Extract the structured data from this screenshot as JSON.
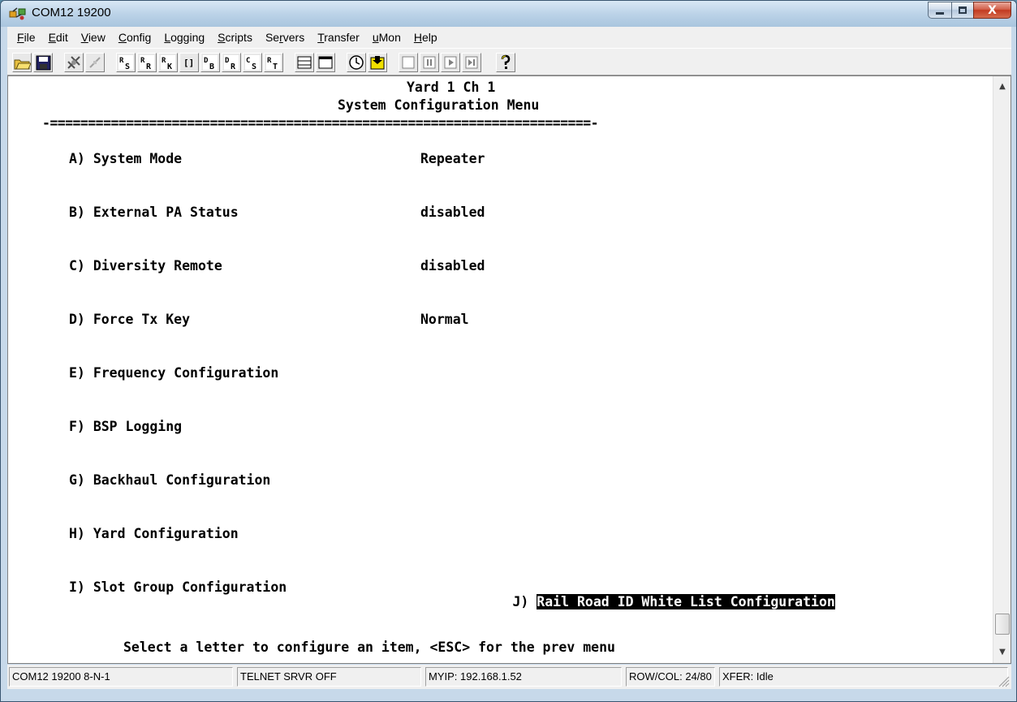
{
  "window": {
    "title": "COM12 19200",
    "controls": {
      "minimize": "minimize",
      "maximize": "maximize",
      "close": "X"
    }
  },
  "menu": [
    {
      "label": "File",
      "ul": "F",
      "rest": "ile"
    },
    {
      "label": "Edit",
      "ul": "E",
      "rest": "dit"
    },
    {
      "label": "View",
      "ul": "V",
      "rest": "iew"
    },
    {
      "label": "Config",
      "ul": "C",
      "rest": "onfig"
    },
    {
      "label": "Logging",
      "ul": "L",
      "rest": "ogging"
    },
    {
      "label": "Scripts",
      "ul": "S",
      "rest": "cripts"
    },
    {
      "label": "Servers",
      "pre": "Se",
      "ul": "r",
      "rest": "vers"
    },
    {
      "label": "Transfer",
      "ul": "T",
      "rest": "ransfer"
    },
    {
      "label": "uMon",
      "ul": "u",
      "rest": "Mon"
    },
    {
      "label": "Help",
      "ul": "H",
      "rest": "elp"
    }
  ],
  "toolbar_icons": [
    "open-folder-icon",
    "save-icon",
    "connect-icon",
    "disconnect-icon",
    "send-s-icon",
    "receive-r-icon",
    "receive-k-icon",
    "brackets-icon",
    "send-b-icon",
    "send-r-icon",
    "send-c-icon",
    "receive-t-icon",
    "window-split-icon",
    "window-icon",
    "clock-icon",
    "folder-arrow-icon",
    "stop-icon",
    "pause-icon",
    "play-icon",
    "step-icon",
    "help-icon"
  ],
  "terminal": {
    "header1": "Yard 1 Ch 1",
    "header2": "System Configuration Menu",
    "divider": "-=======================================================================-",
    "items": [
      {
        "key": "A)",
        "label": "System Mode",
        "value": "Repeater"
      },
      {
        "key": "B)",
        "label": "External PA Status",
        "value": "disabled"
      },
      {
        "key": "C)",
        "label": "Diversity Remote",
        "value": "disabled"
      },
      {
        "key": "D)",
        "label": "Force Tx Key",
        "value": "Normal"
      },
      {
        "key": "E)",
        "label": "Frequency Configuration",
        "value": ""
      },
      {
        "key": "F)",
        "label": "BSP Logging",
        "value": ""
      },
      {
        "key": "G)",
        "label": "Backhaul Configuration",
        "value": ""
      },
      {
        "key": "H)",
        "label": "Yard Configuration",
        "value": ""
      },
      {
        "key": "I)",
        "label": "Slot Group Configuration",
        "value": ""
      }
    ],
    "item_j": {
      "key": "J)",
      "label": "Rail Road ID White List Configuration"
    },
    "prompt": "Select a letter to configure an item, <ESC> for the prev menu"
  },
  "status": {
    "port": "COM12 19200 8-N-1",
    "telnet": "TELNET SRVR OFF",
    "myip": "MYIP: 192.168.1.52",
    "rowcol": "ROW/COL: 24/80",
    "xfer": "XFER: Idle"
  }
}
